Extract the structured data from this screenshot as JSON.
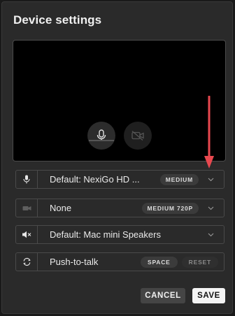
{
  "title": "Device settings",
  "colors": {
    "panel_bg": "#2a2a2a",
    "accent_arrow": "#e8484f",
    "save_bg": "#f4f4f4"
  },
  "preview": {
    "mic_button_icon": "microphone-icon",
    "camera_button_icon": "camera-off-icon"
  },
  "rows": [
    {
      "icon": "microphone-icon",
      "label": "Default: NexiGo HD ...",
      "badge": "MEDIUM"
    },
    {
      "icon": "camera-off-icon",
      "label": "None",
      "badge": "MEDIUM 720P"
    },
    {
      "icon": "speaker-mute-icon",
      "label": "Default: Mac mini Speakers"
    },
    {
      "icon": "push-to-talk-icon",
      "label": "Push-to-talk",
      "key_label": "SPACE",
      "reset_label": "RESET"
    }
  ],
  "actions": {
    "cancel_label": "CANCEL",
    "save_label": "SAVE"
  }
}
